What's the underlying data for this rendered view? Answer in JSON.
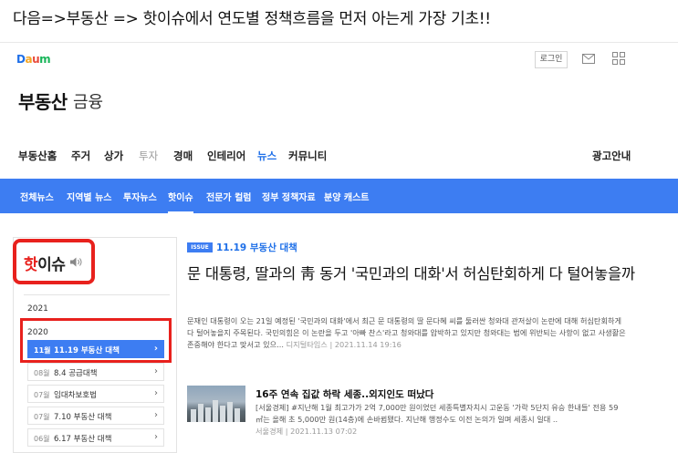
{
  "caption": "다음=>부동산 => 핫이슈에서 연도별 정책흐름을 먼저 아는게 가장 기초!!",
  "header": {
    "logo": {
      "d": "D",
      "a": "a",
      "u": "u",
      "m": "m"
    },
    "login_label": "로그인",
    "mail_icon": "mail-icon",
    "apps_icon": "grid-icon"
  },
  "brand": {
    "title": "부동산",
    "sub": "금융"
  },
  "main_nav": {
    "items": [
      "부동산홈",
      "주거",
      "상가",
      "투자",
      "경매",
      "인테리어",
      "뉴스",
      "커뮤니티"
    ],
    "active": "뉴스",
    "ad_label": "광고안내"
  },
  "sub_nav": {
    "items": [
      "전체뉴스",
      "지역별 뉴스",
      "투자뉴스",
      "핫이슈",
      "전문가 컬럼",
      "정부 정책자료",
      "분양 캐스트"
    ],
    "active": "핫이슈"
  },
  "sidebar": {
    "title_hot": "핫",
    "title_rest": "이슈",
    "speaker_icon": "speaker-icon",
    "years": [
      "2021",
      "2020"
    ],
    "issues": [
      {
        "month": "11월",
        "title": "11.19 부동산 대책",
        "selected": true
      },
      {
        "month": "08월",
        "title": "8.4 공급대책",
        "selected": false
      },
      {
        "month": "07월",
        "title": "임대차보호법",
        "selected": false
      },
      {
        "month": "07월",
        "title": "7.10 부동산 대책",
        "selected": false
      },
      {
        "month": "06월",
        "title": "6.17 부동산 대책",
        "selected": false
      }
    ]
  },
  "article": {
    "badge": "ISSUE",
    "category": "11.19 부동산 대책",
    "headline": "문 대통령, 딸과의 靑 동거 '국민과의 대화'서 허심탄회하게 다 털어놓을까",
    "lede": "문재인 대통령이 오는 21일 예정된 '국민과의 대화'에서 최근 문 대통령의 딸 문다혜 씨를 둘러싼 청와대 관저살이 논란에 대해 허심탄회하게 다 털어놓을지 주목된다. 국민의힘은 이 논란을 두고 '아빠 찬스'라고 청와대를 압박하고 있지만 청와대는 법에 위반되는 사항이 없고 사생활은 존중해야 한다고 맞서고 있으...",
    "source": "디지털타임스",
    "date": "2021.11.14 19:16"
  },
  "sub_article": {
    "title": "16주 연속 집값 하락 세종..외지인도 떠났다",
    "lede": "[서울경제] #지난해 1월 최고가가 2억 7,000만 원이었던 세종특별자치시 고운동 '가락 5단지 유승 한내들' 전용 59㎡는 올해 초 5,000만 원(14층)에 손바뀜됐다. 지난해 행정수도 이전 논의가 일며 세종시 일대 ..",
    "source": "서울경제",
    "date": "2021.11.13 07:02"
  }
}
